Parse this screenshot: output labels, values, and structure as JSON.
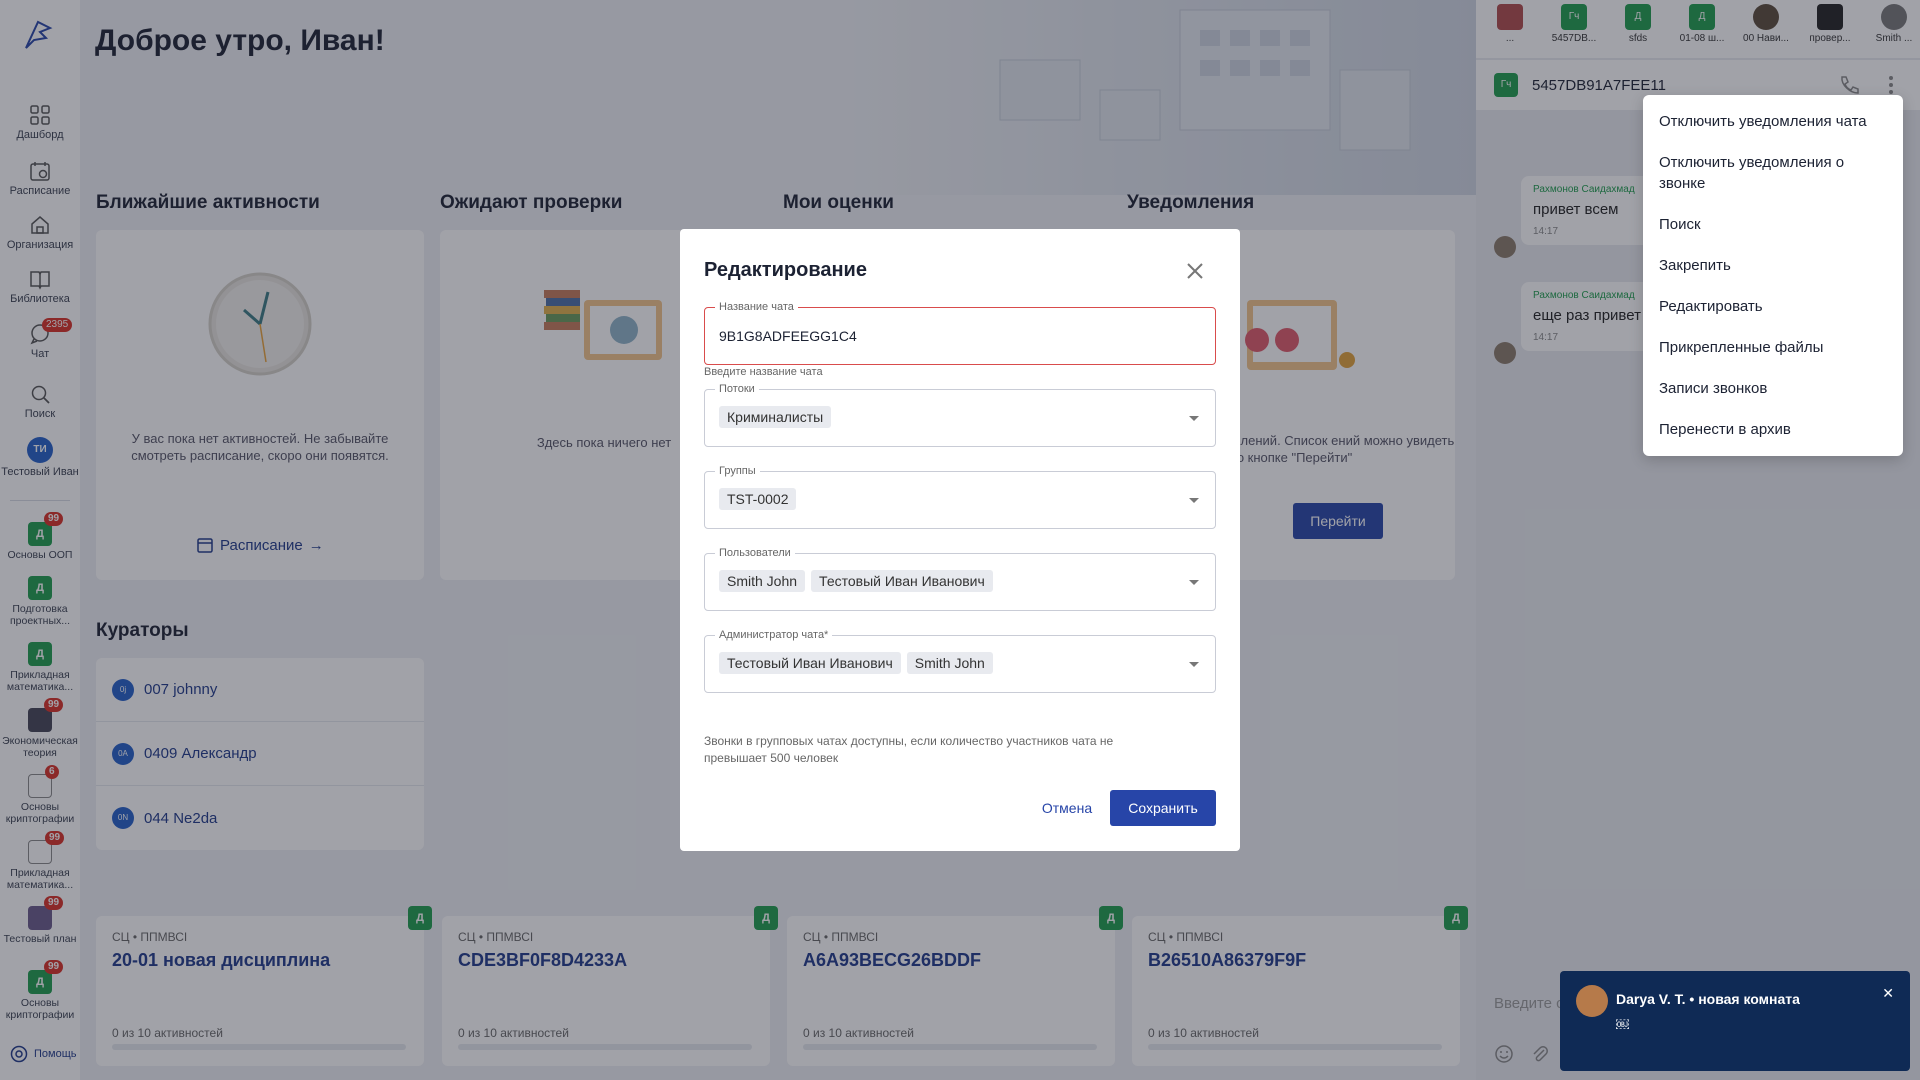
{
  "sidebar": {
    "items": [
      {
        "label": "Дашборд",
        "icon": "grid-icon"
      },
      {
        "label": "Расписание",
        "icon": "calendar-icon"
      },
      {
        "label": "Организация",
        "icon": "home-icon"
      },
      {
        "label": "Библиотека",
        "icon": "book-icon"
      },
      {
        "label": "Чат",
        "icon": "chat-icon",
        "badge": "2395"
      },
      {
        "label": "Поиск",
        "icon": "search-icon"
      }
    ],
    "profile": {
      "initials": "ТИ",
      "name": "Тестовый Иван"
    },
    "courses": [
      {
        "label": "Основы ООП",
        "initials": "Д",
        "badge": "99"
      },
      {
        "label": "Подготовка проектных...",
        "initials": "Д",
        "badge": ""
      },
      {
        "label": "Прикладная математика...",
        "initials": "Д",
        "badge": ""
      },
      {
        "label": "Экономическая теория",
        "initials": "",
        "badge": "99"
      },
      {
        "label": "Основы криптографии",
        "initials": "",
        "badge": "6"
      },
      {
        "label": "Прикладная математика...",
        "initials": "",
        "badge": "99"
      },
      {
        "label": "Тестовый план",
        "initials": "",
        "badge": "99"
      },
      {
        "label": "Основы криптографии",
        "initials": "Д",
        "badge": "99"
      }
    ],
    "help_label": "Помощь"
  },
  "main": {
    "greeting": "Доброе утро, Иван!",
    "sections": {
      "activities": "Ближайшие активности",
      "awaiting": "Ожидают проверки",
      "grades": "Мои оценки",
      "notifications": "Уведомления",
      "curators": "Кураторы"
    },
    "activities_empty": "У вас пока нет активностей. Не забывайте смотреть расписание, скоро они появятся.",
    "schedule_link": "Расписание",
    "awaiting_empty": "Здесь пока ничего нет",
    "notifications_empty": "олученных уведомлений. Список ений можно увидеть по кнопке \"Перейти\"",
    "go_button": "Перейти",
    "curators": [
      {
        "initials": "0j",
        "name": "007 johnny"
      },
      {
        "initials": "0A",
        "name": "0409 Александр"
      },
      {
        "initials": "0N",
        "name": "044 Ne2da"
      }
    ],
    "course_cards": [
      {
        "subtitle": "СЦ • ППМВСI",
        "title": "20-01 новая дисциплина",
        "progress": "0 из 10 активностей",
        "badge": "Д"
      },
      {
        "subtitle": "СЦ • ППМВСI",
        "title": "CDE3BF0F8D4233A",
        "progress": "0 из 10 активностей",
        "badge": "Д"
      },
      {
        "subtitle": "СЦ • ППМВСI",
        "title": "A6A93BECG26BDDF",
        "progress": "0 из 10 активностей",
        "badge": "Д"
      },
      {
        "subtitle": "СЦ • ППМВСI",
        "title": "B26510A86379F9F",
        "progress": "0 из 10 активностей",
        "badge": "Д"
      }
    ]
  },
  "chat": {
    "tabs": [
      {
        "label": "...",
        "initials": ""
      },
      {
        "label": "5457DB...",
        "initials": "Гч"
      },
      {
        "label": "sfds",
        "initials": "Д"
      },
      {
        "label": "01-08 ш...",
        "initials": "Д"
      },
      {
        "label": "00 Нави...",
        "initials": ""
      },
      {
        "label": "провер...",
        "initials": ""
      },
      {
        "label": "Smith ...",
        "initials": ""
      }
    ],
    "header": {
      "initials": "Гч",
      "title": "5457DB91A7FEE11"
    },
    "messages": [
      {
        "author": "Рахмонов Саидахмад",
        "text": "привет всем",
        "time": "14:17"
      },
      {
        "author": "Рахмонов Саидахмад",
        "text": "еще раз привет",
        "time": "14:17"
      }
    ],
    "menu": [
      "Отключить уведомления чата",
      "Отключить уведомления о звонке",
      "Поиск",
      "Закрепить",
      "Редактировать",
      "Прикрепленные файлы",
      "Записи звонков",
      "Перенести в архив"
    ],
    "input_placeholder": "Введите с"
  },
  "modal": {
    "title": "Редактирование",
    "chat_name_label": "Название чата",
    "chat_name_value": "9B1G8ADFEEGG1C4",
    "chat_name_helper": "Введите название чата",
    "streams_label": "Потоки",
    "streams": [
      "Криминалисты"
    ],
    "groups_label": "Группы",
    "groups": [
      "TST-0002"
    ],
    "users_label": "Пользователи",
    "users": [
      "Smith John",
      "Тестовый Иван Иванович"
    ],
    "admin_label": "Администратор чата*",
    "admins": [
      "Тестовый Иван Иванович",
      "Smith John"
    ],
    "note": "Звонки в групповых чатах доступны, если количество участников чата не превышает 500 человек",
    "cancel_label": "Отмена",
    "save_label": "Сохранить"
  },
  "toast": {
    "title": "Darya V. T. • новая комната",
    "body": "￼"
  }
}
